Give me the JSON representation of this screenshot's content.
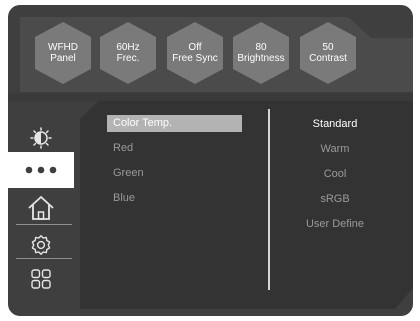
{
  "header": {
    "tiles": [
      {
        "line1": "WFHD",
        "line2": "Panel"
      },
      {
        "line1": "60Hz",
        "line2": "Frec."
      },
      {
        "line1": "Off",
        "line2": "Free Sync"
      },
      {
        "line1": "80",
        "line2": "Brightness"
      },
      {
        "line1": "50",
        "line2": "Contrast"
      }
    ]
  },
  "sidebar": {
    "items": [
      {
        "icon": "sun-icon",
        "active": false
      },
      {
        "icon": "more-dots-icon",
        "active": true
      },
      {
        "icon": "home-icon",
        "active": false
      },
      {
        "icon": "gear-icon",
        "active": false
      },
      {
        "icon": "apps-grid-icon",
        "active": false
      }
    ]
  },
  "menu": {
    "items": [
      "Color Temp.",
      "Red",
      "Green",
      "Blue"
    ],
    "selected": "Color Temp."
  },
  "options": {
    "items": [
      "Standard",
      "Warm",
      "Cool",
      "sRGB",
      "User Define"
    ],
    "selected": "Standard"
  },
  "colors": {
    "panel": "#3f3f3f",
    "content": "#333333",
    "hex_fill": "#7a7a7a",
    "highlight": "#b3b3b3",
    "active_side": "#ffffff"
  }
}
